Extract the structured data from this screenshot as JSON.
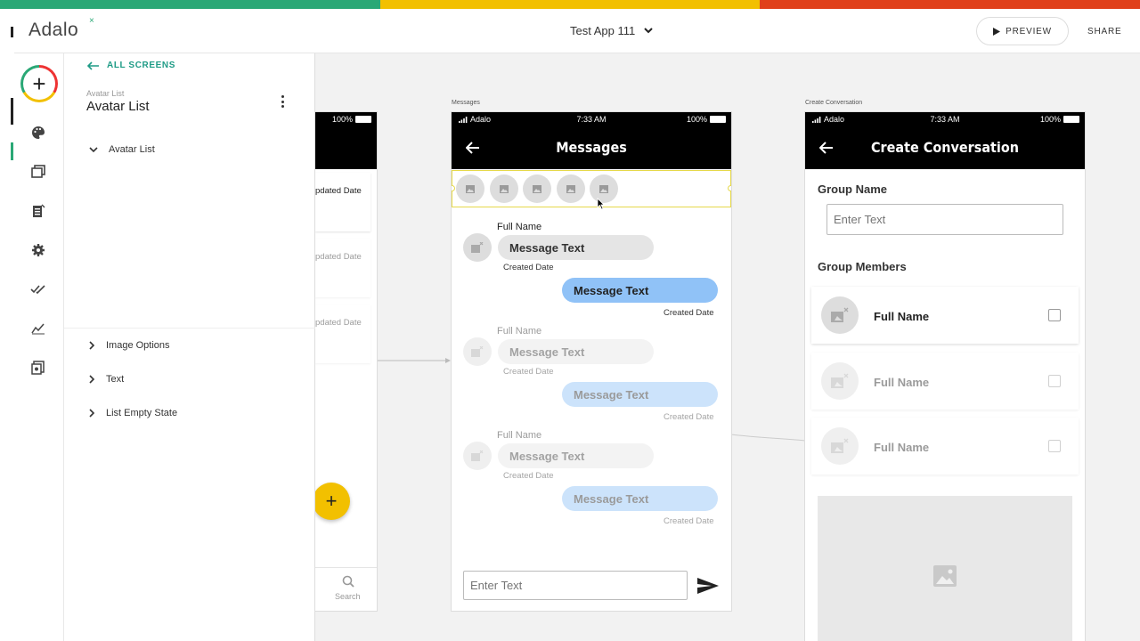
{
  "header": {
    "logo": "Adalo",
    "logo_mark": "×",
    "app_name": "Test App 111",
    "preview_label": "PREVIEW",
    "share_label": "SHARE"
  },
  "colors": {
    "stripe": [
      "#2aa876",
      "#f2c000",
      "#e0401a"
    ],
    "accent": "#1e9b86",
    "sent_bubble": "#90c2f7",
    "received_bubble": "#e5e5e5",
    "fab": "#f2c000",
    "selection": "#e6d94a"
  },
  "rail": {
    "icons": [
      "add-icon",
      "palette-icon",
      "screens-icon",
      "database-icon",
      "settings-icon",
      "publish-icon",
      "analytics-icon",
      "marketplace-icon"
    ]
  },
  "panel": {
    "back_label": "ALL SCREENS",
    "subtitle": "Avatar List",
    "title": "Avatar List",
    "tree_top": "Avatar List",
    "sections": [
      "Image Options",
      "Text",
      "List Empty State"
    ]
  },
  "left_screen": {
    "battery": "100%",
    "rows": [
      "pdated Date",
      "pdated Date",
      "pdated Date"
    ],
    "tab_label": "Search"
  },
  "messages_screen": {
    "label": "Messages",
    "carrier": "Adalo",
    "time": "7:33 AM",
    "battery": "100%",
    "title": "Messages",
    "messages": [
      {
        "name": "Full Name",
        "text": "Message Text",
        "date": "Created Date"
      },
      {
        "text": "Message Text",
        "date": "Created Date"
      },
      {
        "name": "Full Name",
        "text": "Message Text",
        "date": "Created Date"
      },
      {
        "text": "Message Text",
        "date": "Created Date"
      },
      {
        "name": "Full Name",
        "text": "Message Text",
        "date": "Created Date"
      },
      {
        "text": "Message Text",
        "date": "Created Date"
      }
    ],
    "input_placeholder": "Enter Text"
  },
  "create_screen": {
    "label": "Create Conversation",
    "carrier": "Adalo",
    "time": "7:33 AM",
    "battery": "100%",
    "title": "Create Conversation",
    "group_name_label": "Group Name",
    "group_name_placeholder": "Enter Text",
    "group_members_label": "Group Members",
    "members": [
      "Full Name",
      "Full Name",
      "Full Name"
    ]
  }
}
